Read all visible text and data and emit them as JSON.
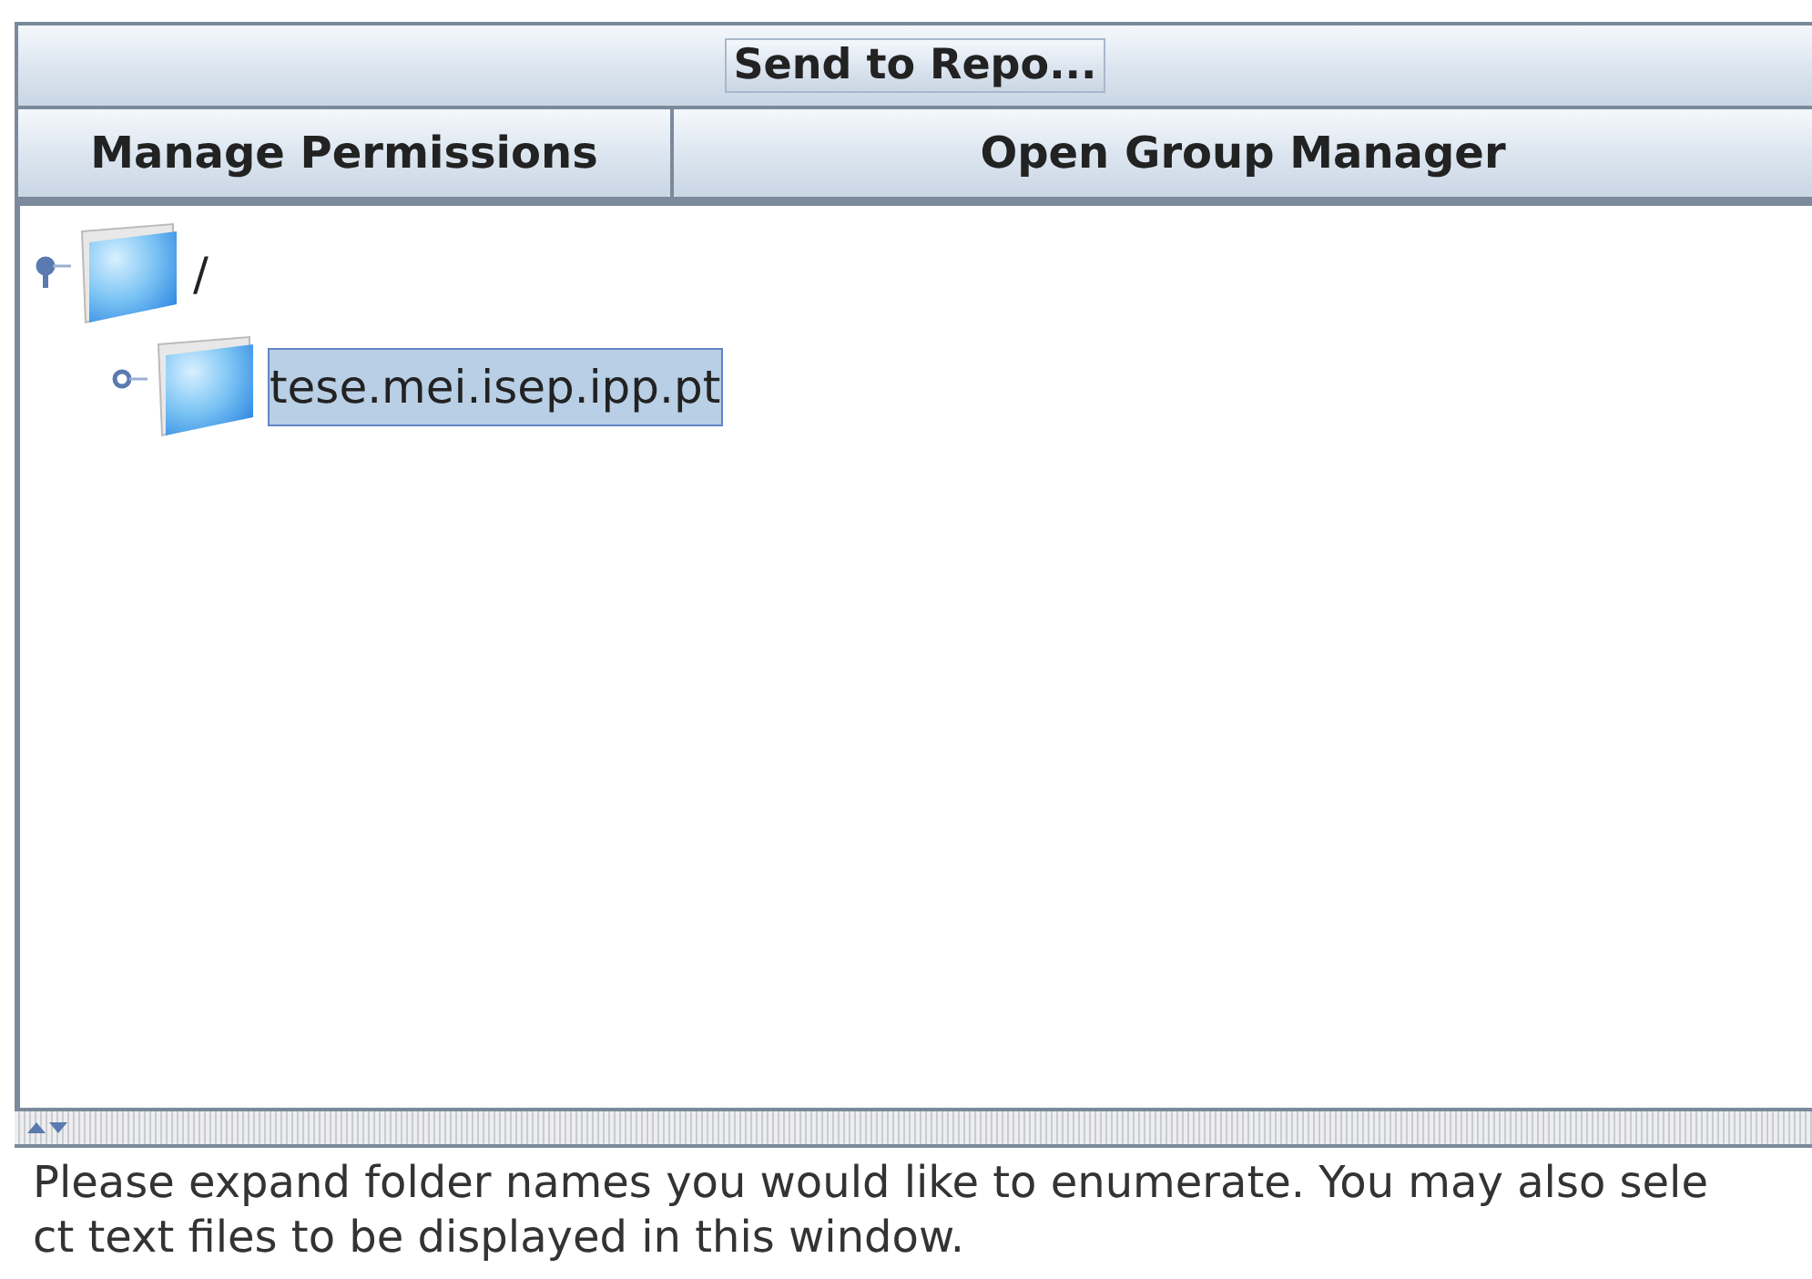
{
  "toolbar": {
    "send_button": "Send to Repo..."
  },
  "actions": [
    "Manage Permissions",
    "Open Group Manager"
  ],
  "tree": [
    {
      "label": "/",
      "selected": false,
      "expanded": true,
      "children": [
        {
          "label": "tese.mei.isep.ipp.pt",
          "selected": true,
          "expanded": false
        }
      ]
    }
  ],
  "message_lines": [
    "Please expand folder names you would like to enumerate.  You may also sele",
    "ct text files to be displayed in this window."
  ]
}
